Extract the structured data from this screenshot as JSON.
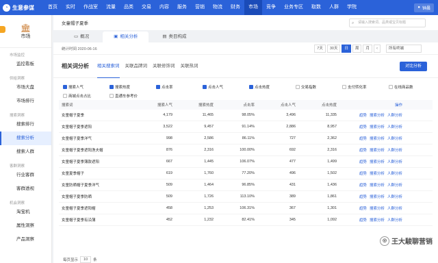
{
  "app": {
    "title": "生意参谋"
  },
  "nav": [
    "首页",
    "实时",
    "作战室",
    "流量",
    "品类",
    "交易",
    "内容",
    "服务",
    "营销",
    "物流",
    "财务",
    "市场",
    "竞争",
    "业务专区",
    "取数",
    "人群",
    "学院"
  ],
  "user": {
    "name": "钟晨"
  },
  "sidebar": {
    "head": "市场",
    "sections": [
      {
        "title": "市场监控",
        "items": [
          "监控看板"
        ]
      },
      {
        "title": "供给洞察",
        "items": [
          "市场大盘",
          "市场排行"
        ]
      },
      {
        "title": "搜索洞察",
        "items": [
          "搜索排行",
          "搜索分析",
          "搜索人群"
        ]
      },
      {
        "title": "客群洞察",
        "items": [
          "行业客群",
          "客群透视"
        ]
      },
      {
        "title": "机会洞察",
        "items": [
          "淘宝机",
          "属性洞察",
          "产品洞察"
        ]
      }
    ],
    "active": "搜索分析"
  },
  "breadcrumb": "女童帽子夏季",
  "search": {
    "placeholder": "请输入搜索词、品类或宝贝标题"
  },
  "tabs": [
    "概况",
    "相关分析",
    "类目构成"
  ],
  "stats": {
    "date_label": "统计时间 2020-06-16",
    "buttons": [
      "7天",
      "30天",
      "日",
      "周",
      "月"
    ],
    "terminal": "所有终端"
  },
  "analysis": {
    "title": "相关词分析",
    "subtabs": [
      "相关搜索词",
      "关联品牌词",
      "关联修饰词",
      "关联热词"
    ],
    "compare": "对比分析"
  },
  "metrics": [
    {
      "label": "搜索人气",
      "on": true
    },
    {
      "label": "搜索热度",
      "on": true
    },
    {
      "label": "点击率",
      "on": true
    },
    {
      "label": "点击人气",
      "on": true
    },
    {
      "label": "点击热度",
      "on": true
    },
    {
      "label": "交易指数",
      "on": false
    },
    {
      "label": "支付转化率",
      "on": false
    },
    {
      "label": "在线商品数",
      "on": false
    },
    {
      "label": "商城点击占比",
      "on": false
    },
    {
      "label": "直通车参考价",
      "on": false
    }
  ],
  "table": {
    "headers": [
      "搜索词",
      "搜索人气",
      "搜索热度",
      "点击率",
      "点击人气",
      "点击热度",
      "操作"
    ],
    "actions": [
      "趋势",
      "搜索分析",
      "人群分析"
    ],
    "rows": [
      [
        "女童帽子夏季",
        "4,179",
        "11,465",
        "98.05%",
        "3,496",
        "11,335"
      ],
      [
        "女童帽子夏季遮阳",
        "3,522",
        "9,457",
        "91.14%",
        "2,886",
        "8,957"
      ],
      [
        "女童帽子夏季洋气",
        "998",
        "2,586",
        "86.11%",
        "727",
        "2,362"
      ],
      [
        "女童帽子夏季遮阳渔夫帽",
        "876",
        "2,316",
        "100.00%",
        "692",
        "2,316"
      ],
      [
        "女童帽子夏季薄款遮阳",
        "667",
        "1,445",
        "106.07%",
        "477",
        "1,499"
      ],
      [
        "女童夏季帽子",
        "619",
        "1,760",
        "77.20%",
        "496",
        "1,502"
      ],
      [
        "女童防晒帽子夏季洋气",
        "509",
        "1,464",
        "96.85%",
        "431",
        "1,436"
      ],
      [
        "女童帽子夏季防晒",
        "509",
        "1,726",
        "113.10%",
        "389",
        "1,861"
      ],
      [
        "女童帽子夏季遮阳帽",
        "458",
        "1,253",
        "106.31%",
        "367",
        "1,301"
      ],
      [
        "女童帽子夏季有沿薄",
        "452",
        "1,232",
        "82.41%",
        "345",
        "1,092"
      ]
    ]
  },
  "footer": {
    "label": "每页显示",
    "value": "10",
    "suffix": "条"
  },
  "watermark": "王大駿聊营销"
}
